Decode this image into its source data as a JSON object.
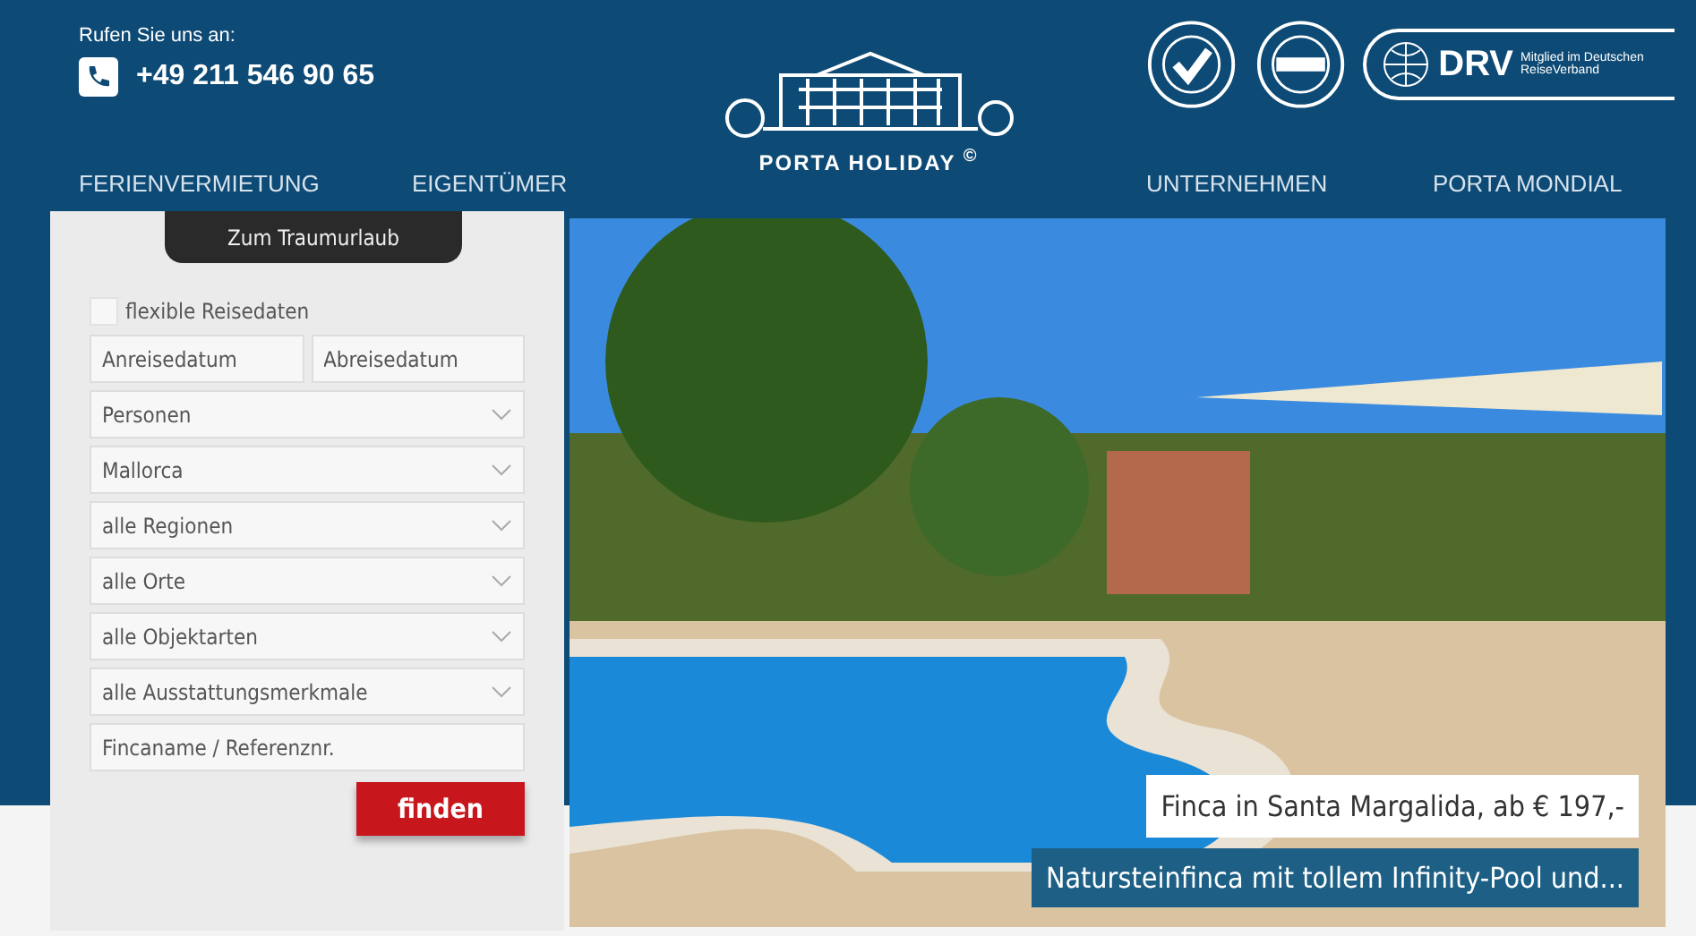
{
  "header": {
    "phone_label": "Rufen Sie uns an:",
    "phone": "+49 211 546 90 65",
    "logo": {
      "name": "PORTA HOLIDAY",
      "mark": "©"
    },
    "nav": [
      {
        "label": "FERIENVERMIETUNG"
      },
      {
        "label": "EIGENTÜMER"
      },
      {
        "label": "UNTERNEHMEN"
      },
      {
        "label": "PORTA MONDIAL"
      }
    ],
    "drv": {
      "name": "DRV",
      "caption": "Mitglied im Deutschen ReiseVerband"
    }
  },
  "search": {
    "title": "Zum Traumurlaub",
    "flexible": {
      "label": "flexible Reisedaten",
      "checked": false
    },
    "dates": [
      {
        "placeholder": "Anreisedatum"
      },
      {
        "placeholder": "Abreisedatum"
      }
    ],
    "selects": [
      {
        "value": "Personen"
      },
      {
        "value": "Mallorca"
      },
      {
        "value": "alle Regionen"
      },
      {
        "value": "alle Orte"
      },
      {
        "value": "alle Objektarten"
      },
      {
        "value": "alle Ausstattungsmerkmale"
      }
    ],
    "name_field": {
      "placeholder": "Fincaname / Referenznr."
    },
    "button": "finden"
  },
  "feature": {
    "title": "Finca in Santa Margalida, ab € 197,-",
    "subtitle": "Natursteinfinca mit tollem Infinity-Pool und..."
  }
}
